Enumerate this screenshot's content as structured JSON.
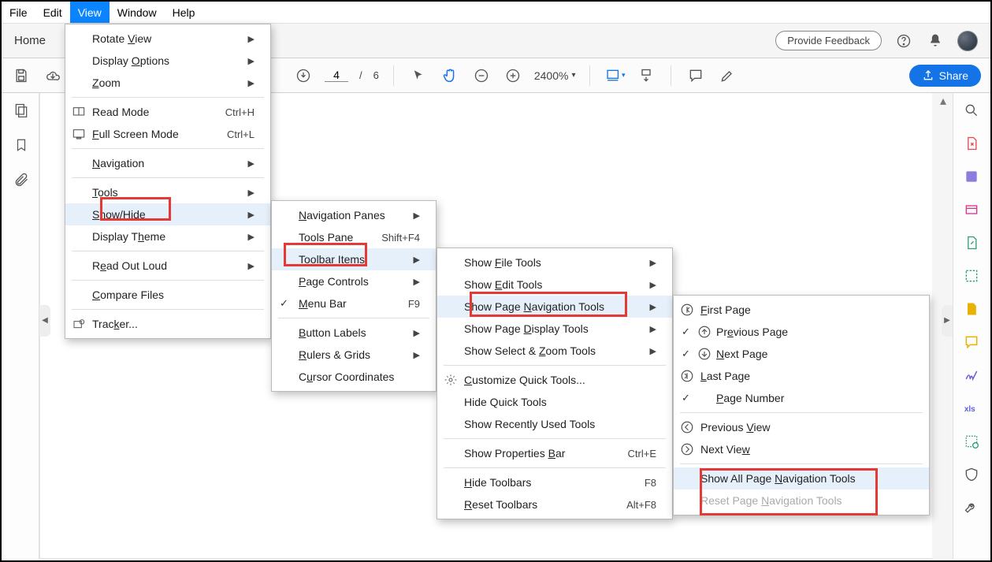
{
  "menubar": {
    "items": [
      "File",
      "Edit",
      "View",
      "Window",
      "Help"
    ],
    "active_index": 2
  },
  "appbar": {
    "home": "Home",
    "feedback": "Provide Feedback"
  },
  "toolbar": {
    "page_cur": "4",
    "page_sep": "/",
    "page_total": "6",
    "zoom": "2400%",
    "share": "Share"
  },
  "view_menu": {
    "rotate": "Rotate View",
    "display_opts": "Display Options",
    "zoom": "Zoom",
    "read_mode": "Read Mode",
    "read_mode_sc": "Ctrl+H",
    "full_screen": "Full Screen Mode",
    "full_screen_sc": "Ctrl+L",
    "navigation": "Navigation",
    "tools": "Tools",
    "show_hide": "Show/Hide",
    "display_theme": "Display Theme",
    "read_out": "Read Out Loud",
    "compare": "Compare Files",
    "tracker": "Tracker..."
  },
  "showhide_menu": {
    "nav_panes": "Navigation Panes",
    "tools_pane": "Tools Pane",
    "tools_pane_sc": "Shift+F4",
    "toolbar_items": "Toolbar Items",
    "page_controls": "Page Controls",
    "menu_bar": "Menu Bar",
    "menu_bar_sc": "F9",
    "button_labels": "Button Labels",
    "rulers": "Rulers & Grids",
    "cursor": "Cursor Coordinates"
  },
  "toolbaritems_menu": {
    "file_tools": "Show File Tools",
    "edit_tools": "Show Edit Tools",
    "nav_tools": "Show Page Navigation Tools",
    "display_tools": "Show Page Display Tools",
    "zoom_tools": "Show Select & Zoom Tools",
    "customize": "Customize Quick Tools...",
    "hide_quick": "Hide Quick Tools",
    "recent": "Show Recently Used Tools",
    "properties": "Show Properties Bar",
    "properties_sc": "Ctrl+E",
    "hide_tb": "Hide Toolbars",
    "hide_tb_sc": "F8",
    "reset_tb": "Reset Toolbars",
    "reset_tb_sc": "Alt+F8"
  },
  "navtools_menu": {
    "first": "First Page",
    "prev": "Previous Page",
    "next": "Next Page",
    "last": "Last Page",
    "page_num": "Page Number",
    "prev_view": "Previous View",
    "next_view": "Next View",
    "show_all": "Show All Page Navigation Tools",
    "reset": "Reset Page Navigation Tools"
  }
}
